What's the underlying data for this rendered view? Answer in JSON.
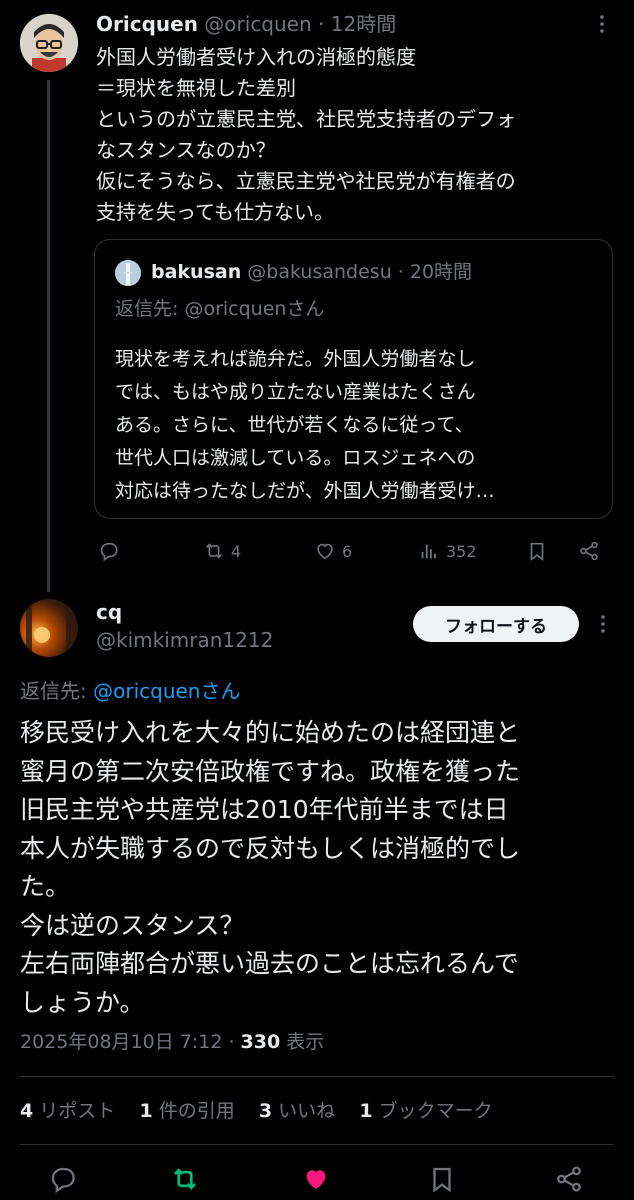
{
  "tweet1": {
    "display_name": "Oricquen",
    "handle": "@oricquen",
    "time": "· 12時間",
    "body_lines": [
      "外国人労働者受け入れの消極的態度",
      "＝現状を無視した差別",
      "というのが立憲民主党、社民党支持者のデフォ",
      "なスタンスなのか？",
      "仮にそうなら、立憲民主党や社民党が有権者の",
      "支持を失っても仕方ない。"
    ],
    "quote": {
      "display_name": "bakusan",
      "handle": "@bakusandesu",
      "time": "· 20時間",
      "reply_to": "返信先: @oricquenさん",
      "body_lines": [
        "現状を考えれば詭弁だ。外国人労働者なし",
        "では、もはや成り立たない産業はたくさん",
        "ある。さらに、世代が若くなるに従って、",
        "世代人口は激減している。ロスジェネへの",
        "対応は待ったなしだが、外国人労働者受け…"
      ]
    },
    "actions": {
      "reposts": "4",
      "likes": "6",
      "views": "352"
    }
  },
  "tweet2": {
    "display_name": "cq",
    "handle": "@kimkimran1212",
    "follow_label": "フォローする",
    "reply_prefix": "返信先: ",
    "reply_to": "@oricquenさん",
    "body_lines": [
      "移民受け入れを大々的に始めたのは経団連と",
      "蜜月の第二次安倍政権ですね。政権を獲った",
      "旧民主党や共産党は2010年代前半までは日",
      "本人が失職するので反対もしくは消極的でし",
      "た。",
      "今は逆のスタンス？",
      "左右両陣都合が悪い過去のことは忘れるんで",
      "しょうか。"
    ],
    "timestamp": "2025年08月10日 7:12 · ",
    "views_count": "330",
    "views_label": " 表示",
    "stats": {
      "reposts_count": "4",
      "reposts_label": " リポスト",
      "quotes_count": "1",
      "quotes_label": " 件の引用",
      "likes_count": "3",
      "likes_label": " いいね",
      "bookmarks_count": "1",
      "bookmarks_label": " ブックマーク"
    }
  },
  "colors": {
    "background": "#000000",
    "text": "#e7e9ea",
    "muted": "#71767b",
    "link": "#1d9bf0",
    "repost_active": "#00ba7c",
    "like_active": "#f91880"
  },
  "icons": [
    "more-icon",
    "reply-icon",
    "repost-icon",
    "like-icon",
    "views-icon",
    "bookmark-icon",
    "share-icon"
  ]
}
